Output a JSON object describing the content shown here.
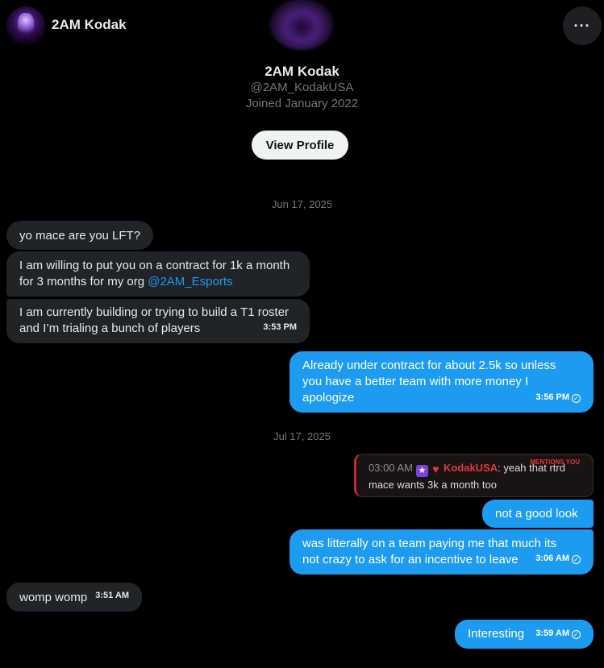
{
  "header": {
    "name": "2AM Kodak",
    "more_icon": "more-horizontal-icon",
    "more_label": "···"
  },
  "profile": {
    "name": "2AM Kodak",
    "handle": "@2AM_KodakUSA",
    "joined": "Joined January 2022",
    "view_profile_label": "View Profile"
  },
  "dates": [
    "Jun 17, 2025",
    "Jul 17, 2025"
  ],
  "messages": {
    "m1": {
      "text": "yo mace are you LFT?"
    },
    "m2": {
      "text_a": "I am willing to put you on a contract for 1k a month",
      "text_b": "for 3 months for my org ",
      "mention": "@2AM_Esports"
    },
    "m3": {
      "text_a": "I am currently building or trying to build a T1 roster",
      "text_b": "and I’m trialing a bunch of players",
      "time": "3:53 PM"
    },
    "m4": {
      "text_a": "Already under contract for about 2.5k so unless",
      "text_b": "you have a better team with more money I",
      "text_c": "apologize",
      "time": "3:56 PM"
    },
    "quote": {
      "tag": "MENTIONS YOU",
      "time": "03:00 AM",
      "user": "KodakUSA",
      "text_a": ": yeah that rtrd",
      "text_b": "mace wants 3k a month too",
      "badge_star": "★",
      "badge_heart": "♥"
    },
    "m5": {
      "text": "not a good look"
    },
    "m6": {
      "text_a": "was litterally on a team paying me that much its",
      "text_b": "not crazy to ask for an incentive to leave",
      "time": "3:06 AM"
    },
    "m7": {
      "text": "womp womp",
      "time": "3:51 AM"
    },
    "m8": {
      "text": "Interesting",
      "time": "3:59 AM"
    }
  },
  "check_glyph": "✓",
  "colors": {
    "sent_bubble": "#1d9bf0",
    "received_bubble": "#202327",
    "background": "#000000",
    "mention_red": "#e0393e"
  }
}
